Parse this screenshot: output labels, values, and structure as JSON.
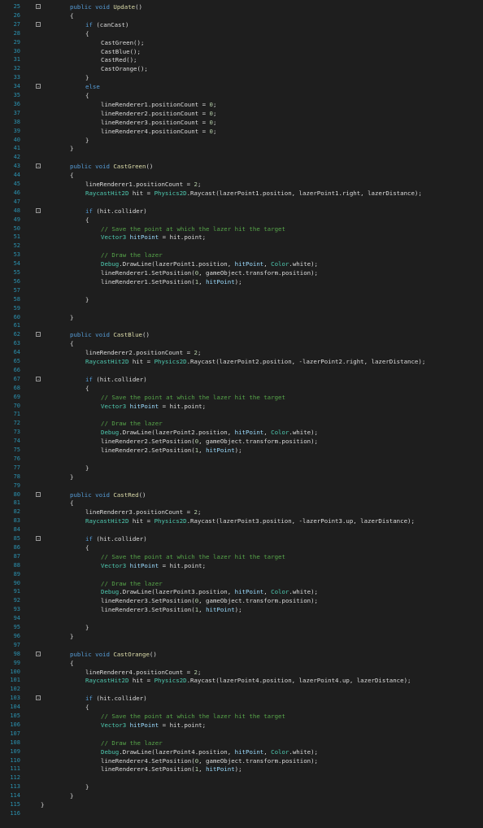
{
  "editor": {
    "lines": [
      {
        "n": "25",
        "fold": "-",
        "t": [
          [
            "kw",
            "public void "
          ],
          [
            "mt",
            "Update"
          ],
          [
            "pl",
            "()"
          ]
        ]
      },
      {
        "n": "26",
        "t": [
          [
            "pl",
            "{"
          ]
        ]
      },
      {
        "n": "27",
        "fold": "-",
        "t": [
          [
            "kw",
            "if "
          ],
          [
            "pl",
            "(canCast)"
          ]
        ]
      },
      {
        "n": "28",
        "t": [
          [
            "pl",
            "{"
          ]
        ]
      },
      {
        "n": "29",
        "t": [
          [
            "pl",
            "CastGreen();"
          ]
        ]
      },
      {
        "n": "30",
        "t": [
          [
            "pl",
            "CastBlue();"
          ]
        ]
      },
      {
        "n": "31",
        "t": [
          [
            "pl",
            "CastRed();"
          ]
        ]
      },
      {
        "n": "32",
        "t": [
          [
            "pl",
            "CastOrange();"
          ]
        ]
      },
      {
        "n": "33",
        "t": [
          [
            "pl",
            "}"
          ]
        ]
      },
      {
        "n": "34",
        "fold": "-",
        "t": [
          [
            "kw",
            "else"
          ]
        ]
      },
      {
        "n": "35",
        "t": [
          [
            "pl",
            "{"
          ]
        ]
      },
      {
        "n": "36",
        "t": [
          [
            "pl",
            "lineRenderer1.positionCount = "
          ],
          [
            "nu",
            "0"
          ],
          [
            "pl",
            ";"
          ]
        ]
      },
      {
        "n": "37",
        "t": [
          [
            "pl",
            "lineRenderer2.positionCount = "
          ],
          [
            "nu",
            "0"
          ],
          [
            "pl",
            ";"
          ]
        ]
      },
      {
        "n": "38",
        "t": [
          [
            "pl",
            "lineRenderer3.positionCount = "
          ],
          [
            "nu",
            "0"
          ],
          [
            "pl",
            ";"
          ]
        ]
      },
      {
        "n": "39",
        "t": [
          [
            "pl",
            "lineRenderer4.positionCount = "
          ],
          [
            "nu",
            "0"
          ],
          [
            "pl",
            ";"
          ]
        ]
      },
      {
        "n": "40",
        "t": [
          [
            "pl",
            "}"
          ]
        ]
      },
      {
        "n": "41",
        "t": [
          [
            "pl",
            "}"
          ]
        ]
      },
      {
        "n": "42",
        "t": []
      },
      {
        "n": "43",
        "fold": "-",
        "t": [
          [
            "kw",
            "public void "
          ],
          [
            "mt",
            "CastGreen"
          ],
          [
            "pl",
            "()"
          ]
        ]
      },
      {
        "n": "44",
        "t": [
          [
            "pl",
            "{"
          ]
        ]
      },
      {
        "n": "45",
        "t": [
          [
            "pl",
            "lineRenderer1.positionCount = "
          ],
          [
            "nu",
            "2"
          ],
          [
            "pl",
            ";"
          ]
        ]
      },
      {
        "n": "46",
        "t": [
          [
            "ty",
            "RaycastHit2D"
          ],
          [
            "pl",
            " hit = "
          ],
          [
            "ty",
            "Physics2D"
          ],
          [
            "pl",
            ".Raycast(lazerPoint1.position, lazerPoint1.right, lazerDistance);"
          ]
        ]
      },
      {
        "n": "47",
        "t": []
      },
      {
        "n": "48",
        "fold": "-",
        "t": [
          [
            "kw",
            "if "
          ],
          [
            "pl",
            "(hit.collider)"
          ]
        ]
      },
      {
        "n": "49",
        "t": [
          [
            "pl",
            "{"
          ]
        ]
      },
      {
        "n": "50",
        "t": [
          [
            "cm",
            "// Save the point at which the lazer hit the target"
          ]
        ]
      },
      {
        "n": "51",
        "t": [
          [
            "ty",
            "Vector3"
          ],
          [
            "pl",
            " "
          ],
          [
            "hl",
            "hitPoint"
          ],
          [
            "pl",
            " = hit.point;"
          ]
        ]
      },
      {
        "n": "52",
        "t": []
      },
      {
        "n": "53",
        "t": [
          [
            "cm",
            "// Draw the lazer"
          ]
        ]
      },
      {
        "n": "54",
        "t": [
          [
            "ty",
            "Debug"
          ],
          [
            "pl",
            ".DrawLine(lazerPoint1.position, "
          ],
          [
            "hl",
            "hitPoint"
          ],
          [
            "pl",
            ", "
          ],
          [
            "ty",
            "Color"
          ],
          [
            "pl",
            ".white);"
          ]
        ]
      },
      {
        "n": "55",
        "t": [
          [
            "pl",
            "lineRenderer1.SetPosition("
          ],
          [
            "nu",
            "0"
          ],
          [
            "pl",
            ", gameObject.transform.position);"
          ]
        ]
      },
      {
        "n": "56",
        "t": [
          [
            "pl",
            "lineRenderer1.SetPosition("
          ],
          [
            "nu",
            "1"
          ],
          [
            "pl",
            ", "
          ],
          [
            "hl",
            "hitPoint"
          ],
          [
            "pl",
            ");"
          ]
        ]
      },
      {
        "n": "57",
        "t": []
      },
      {
        "n": "58",
        "t": [
          [
            "pl",
            "}"
          ]
        ]
      },
      {
        "n": "59",
        "t": []
      },
      {
        "n": "60",
        "t": [
          [
            "pl",
            "}"
          ]
        ]
      },
      {
        "n": "61",
        "t": []
      },
      {
        "n": "62",
        "fold": "-",
        "t": [
          [
            "kw",
            "public void "
          ],
          [
            "mt",
            "CastBlue"
          ],
          [
            "pl",
            "()"
          ]
        ]
      },
      {
        "n": "63",
        "t": [
          [
            "pl",
            "{"
          ]
        ]
      },
      {
        "n": "64",
        "t": [
          [
            "pl",
            "lineRenderer2.positionCount = "
          ],
          [
            "nu",
            "2"
          ],
          [
            "pl",
            ";"
          ]
        ]
      },
      {
        "n": "65",
        "t": [
          [
            "ty",
            "RaycastHit2D"
          ],
          [
            "pl",
            " hit = "
          ],
          [
            "ty",
            "Physics2D"
          ],
          [
            "pl",
            ".Raycast(lazerPoint2.position, -lazerPoint2.right, lazerDistance);"
          ]
        ]
      },
      {
        "n": "66",
        "t": []
      },
      {
        "n": "67",
        "fold": "-",
        "t": [
          [
            "kw",
            "if "
          ],
          [
            "pl",
            "(hit.collider)"
          ]
        ]
      },
      {
        "n": "68",
        "t": [
          [
            "pl",
            "{"
          ]
        ]
      },
      {
        "n": "69",
        "t": [
          [
            "cm",
            "// Save the point at which the lazer hit the target"
          ]
        ]
      },
      {
        "n": "70",
        "t": [
          [
            "ty",
            "Vector3"
          ],
          [
            "pl",
            " "
          ],
          [
            "hl",
            "hitPoint"
          ],
          [
            "pl",
            " = hit.point;"
          ]
        ]
      },
      {
        "n": "71",
        "t": []
      },
      {
        "n": "72",
        "t": [
          [
            "cm",
            "// Draw the lazer"
          ]
        ]
      },
      {
        "n": "73",
        "t": [
          [
            "ty",
            "Debug"
          ],
          [
            "pl",
            ".DrawLine(lazerPoint2.position, "
          ],
          [
            "hl",
            "hitPoint"
          ],
          [
            "pl",
            ", "
          ],
          [
            "ty",
            "Color"
          ],
          [
            "pl",
            ".white);"
          ]
        ]
      },
      {
        "n": "74",
        "t": [
          [
            "pl",
            "lineRenderer2.SetPosition("
          ],
          [
            "nu",
            "0"
          ],
          [
            "pl",
            ", gameObject.transform.position);"
          ]
        ]
      },
      {
        "n": "75",
        "t": [
          [
            "pl",
            "lineRenderer2.SetPosition("
          ],
          [
            "nu",
            "1"
          ],
          [
            "pl",
            ", "
          ],
          [
            "hl",
            "hitPoint"
          ],
          [
            "pl",
            ");"
          ]
        ]
      },
      {
        "n": "76",
        "t": []
      },
      {
        "n": "77",
        "t": [
          [
            "pl",
            "}"
          ]
        ]
      },
      {
        "n": "78",
        "t": [
          [
            "pl",
            "}"
          ]
        ]
      },
      {
        "n": "79",
        "t": []
      },
      {
        "n": "80",
        "fold": "-",
        "t": [
          [
            "kw",
            "public void "
          ],
          [
            "mt",
            "CastRed"
          ],
          [
            "pl",
            "()"
          ]
        ]
      },
      {
        "n": "81",
        "t": [
          [
            "pl",
            "{"
          ]
        ]
      },
      {
        "n": "82",
        "t": [
          [
            "pl",
            "lineRenderer3.positionCount = "
          ],
          [
            "nu",
            "2"
          ],
          [
            "pl",
            ";"
          ]
        ]
      },
      {
        "n": "83",
        "t": [
          [
            "ty",
            "RaycastHit2D"
          ],
          [
            "pl",
            " hit = "
          ],
          [
            "ty",
            "Physics2D"
          ],
          [
            "pl",
            ".Raycast(lazerPoint3.position, -lazerPoint3.up, lazerDistance);"
          ]
        ]
      },
      {
        "n": "84",
        "t": []
      },
      {
        "n": "85",
        "fold": "-",
        "t": [
          [
            "kw",
            "if "
          ],
          [
            "pl",
            "(hit.collider)"
          ]
        ]
      },
      {
        "n": "86",
        "t": [
          [
            "pl",
            "{"
          ]
        ]
      },
      {
        "n": "87",
        "t": [
          [
            "cm",
            "// Save the point at which the lazer hit the target"
          ]
        ]
      },
      {
        "n": "88",
        "t": [
          [
            "ty",
            "Vector3"
          ],
          [
            "pl",
            " "
          ],
          [
            "hl",
            "hitPoint"
          ],
          [
            "pl",
            " = hit.point;"
          ]
        ]
      },
      {
        "n": "89",
        "t": []
      },
      {
        "n": "90",
        "t": [
          [
            "cm",
            "// Draw the lazer"
          ]
        ]
      },
      {
        "n": "91",
        "t": [
          [
            "ty",
            "Debug"
          ],
          [
            "pl",
            ".DrawLine(lazerPoint3.position, "
          ],
          [
            "hl",
            "hitPoint"
          ],
          [
            "pl",
            ", "
          ],
          [
            "ty",
            "Color"
          ],
          [
            "pl",
            ".white);"
          ]
        ]
      },
      {
        "n": "92",
        "t": [
          [
            "pl",
            "lineRenderer3.SetPosition("
          ],
          [
            "nu",
            "0"
          ],
          [
            "pl",
            ", gameObject.transform.position);"
          ]
        ]
      },
      {
        "n": "93",
        "t": [
          [
            "pl",
            "lineRenderer3.SetPosition("
          ],
          [
            "nu",
            "1"
          ],
          [
            "pl",
            ", "
          ],
          [
            "hl",
            "hitPoint"
          ],
          [
            "pl",
            ");"
          ]
        ]
      },
      {
        "n": "94",
        "t": []
      },
      {
        "n": "95",
        "t": [
          [
            "pl",
            "}"
          ]
        ]
      },
      {
        "n": "96",
        "t": [
          [
            "pl",
            "}"
          ]
        ]
      },
      {
        "n": "97",
        "t": []
      },
      {
        "n": "98",
        "fold": "-",
        "t": [
          [
            "kw",
            "public void "
          ],
          [
            "mt",
            "CastOrange"
          ],
          [
            "pl",
            "()"
          ]
        ]
      },
      {
        "n": "99",
        "t": [
          [
            "pl",
            "{"
          ]
        ]
      },
      {
        "n": "100",
        "t": [
          [
            "pl",
            "lineRenderer4.positionCount = "
          ],
          [
            "nu",
            "2"
          ],
          [
            "pl",
            ";"
          ]
        ]
      },
      {
        "n": "101",
        "t": [
          [
            "ty",
            "RaycastHit2D"
          ],
          [
            "pl",
            " hit = "
          ],
          [
            "ty",
            "Physics2D"
          ],
          [
            "pl",
            ".Raycast(lazerPoint4.position, lazerPoint4.up, lazerDistance);"
          ]
        ]
      },
      {
        "n": "102",
        "t": []
      },
      {
        "n": "103",
        "fold": "-",
        "t": [
          [
            "kw",
            "if "
          ],
          [
            "pl",
            "(hit.collider)"
          ]
        ]
      },
      {
        "n": "104",
        "t": [
          [
            "pl",
            "{"
          ]
        ]
      },
      {
        "n": "105",
        "t": [
          [
            "cm",
            "// Save the point at which the lazer hit the target"
          ]
        ]
      },
      {
        "n": "106",
        "t": [
          [
            "ty",
            "Vector3"
          ],
          [
            "pl",
            " "
          ],
          [
            "hl",
            "hitPoint"
          ],
          [
            "pl",
            " = hit.point;"
          ]
        ]
      },
      {
        "n": "107",
        "t": []
      },
      {
        "n": "108",
        "t": [
          [
            "cm",
            "// Draw the lazer"
          ]
        ]
      },
      {
        "n": "109",
        "t": [
          [
            "ty",
            "Debug"
          ],
          [
            "pl",
            ".DrawLine(lazerPoint4.position, "
          ],
          [
            "hl",
            "hitPoint"
          ],
          [
            "pl",
            ", "
          ],
          [
            "ty",
            "Color"
          ],
          [
            "pl",
            ".white);"
          ]
        ]
      },
      {
        "n": "110",
        "t": [
          [
            "pl",
            "lineRenderer4.SetPosition("
          ],
          [
            "nu",
            "0"
          ],
          [
            "pl",
            ", gameObject.transform.position);"
          ]
        ]
      },
      {
        "n": "111",
        "t": [
          [
            "pl",
            "lineRenderer4.SetPosition("
          ],
          [
            "nu",
            "1"
          ],
          [
            "pl",
            ", "
          ],
          [
            "hl",
            "hitPoint"
          ],
          [
            "pl",
            ");"
          ]
        ]
      },
      {
        "n": "112",
        "t": []
      },
      {
        "n": "113",
        "t": [
          [
            "pl",
            "}"
          ]
        ]
      },
      {
        "n": "114",
        "t": [
          [
            "pl",
            "}"
          ]
        ]
      },
      {
        "n": "115",
        "t": [
          [
            "pl",
            "}"
          ]
        ]
      },
      {
        "n": "116",
        "t": []
      }
    ]
  }
}
